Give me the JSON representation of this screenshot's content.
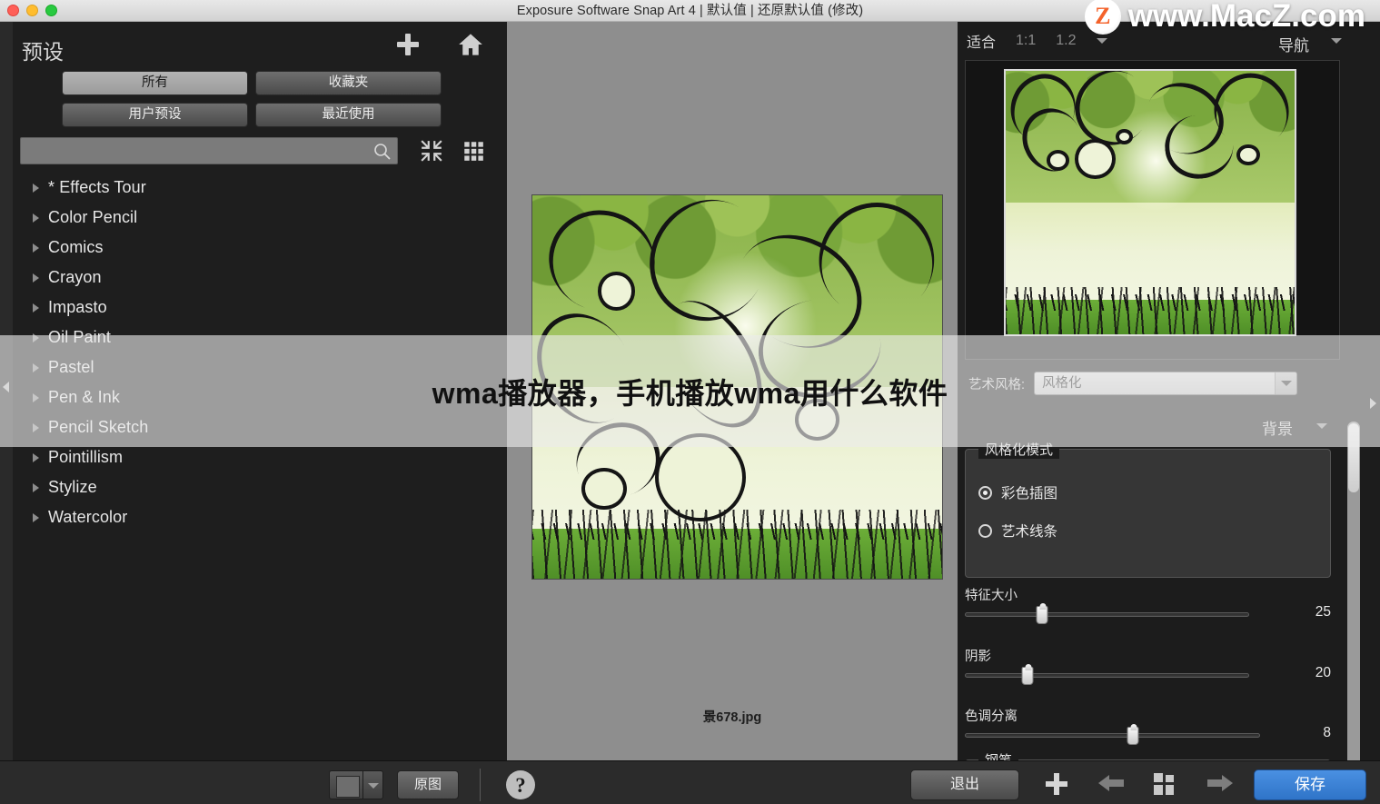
{
  "window": {
    "title": "Exposure Software Snap Art 4 | 默认值 | 还原默认值 (修改)",
    "traffic_lights": [
      "close",
      "minimize",
      "maximize"
    ]
  },
  "left_panel": {
    "title": "预设",
    "add_icon": "plus-icon",
    "home_icon": "home-icon",
    "category_buttons": [
      {
        "label": "所有",
        "active": true
      },
      {
        "label": "收藏夹",
        "active": false
      },
      {
        "label": "用户预设",
        "active": false
      },
      {
        "label": "最近使用",
        "active": false
      }
    ],
    "search": {
      "value": "",
      "placeholder": ""
    },
    "collapse_icon": "collapse-arrows-icon",
    "grid_icon": "grid-view-icon",
    "presets": [
      {
        "label": "* Effects Tour"
      },
      {
        "label": "Color Pencil"
      },
      {
        "label": "Comics"
      },
      {
        "label": "Crayon"
      },
      {
        "label": "Impasto"
      },
      {
        "label": "Oil Paint"
      },
      {
        "label": "Pastel"
      },
      {
        "label": "Pen & Ink"
      },
      {
        "label": "Pencil Sketch"
      },
      {
        "label": "Pointillism"
      },
      {
        "label": "Stylize"
      },
      {
        "label": "Watercolor"
      }
    ]
  },
  "canvas": {
    "filename": "景678.jpg"
  },
  "right_panel": {
    "zoom_controls": [
      {
        "label": "适合",
        "active": true
      },
      {
        "label": "1:1",
        "active": false
      },
      {
        "label": "1.2",
        "active": false
      }
    ],
    "navigator_label": "导航",
    "art_style": {
      "label": "艺术风格:",
      "value": "风格化"
    },
    "background_label": "背景",
    "mode_group": {
      "legend": "风格化模式",
      "options": [
        {
          "label": "彩色插图",
          "selected": true
        },
        {
          "label": "艺术线条",
          "selected": false
        }
      ]
    },
    "sliders": [
      {
        "label": "特征大小",
        "value": "25",
        "percent": 27
      },
      {
        "label": "阴影",
        "value": "20",
        "percent": 22
      },
      {
        "label": "色调分离",
        "value": "8",
        "percent": 57
      }
    ],
    "pen_group_legend": "钢笔"
  },
  "bottom_bar": {
    "swatch_icon": "color-swatch-icon",
    "swatch_caret_icon": "chevron-down-icon",
    "original_label": "原图",
    "help_icon": "help-icon",
    "exit_label": "退出",
    "add_icon": "plus-icon",
    "prev_icon": "arrow-left-icon",
    "grid_icon": "grid-icon",
    "next_icon": "arrow-right-icon",
    "save_label": "保存",
    "save_color": "#3d80d4"
  },
  "watermark": {
    "banner_text": "wma播放器，手机播放wma用什么软件",
    "logo_letter": "Z",
    "url": "www.MacZ.com"
  }
}
